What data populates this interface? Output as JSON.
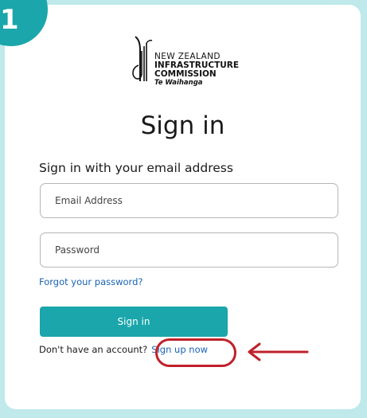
{
  "step": {
    "number": "1"
  },
  "logo": {
    "line1": "NEW ZEALAND",
    "line2": "INFRASTRUCTURE",
    "line3": "COMMISSION",
    "line4": "Te Waihanga",
    "icon": "tuning-fork-logo"
  },
  "signin": {
    "title": "Sign in",
    "subtitle": "Sign in with your email address",
    "email_placeholder": "Email Address",
    "email_value": "",
    "password_placeholder": "Password",
    "password_value": "",
    "forgot_link": "Forgot your password?",
    "button_label": "Sign in",
    "no_account_text": "Don't have an account?",
    "signup_link": "Sign up now"
  },
  "annotation": {
    "highlight_color": "#c0202a",
    "arrow_icon": "left-arrow-icon"
  },
  "colors": {
    "accent": "#1aa6ab",
    "background": "#bfe9ea",
    "link": "#1b63b5",
    "annotation": "#c0202a"
  }
}
